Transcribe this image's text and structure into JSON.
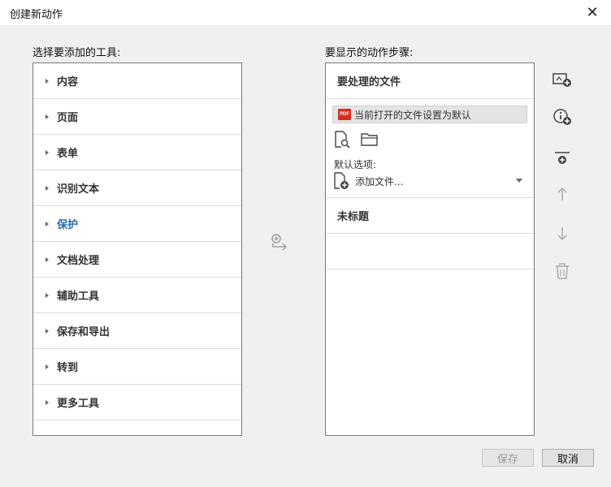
{
  "dialog": {
    "title": "创建新动作",
    "close_label": "✕"
  },
  "tools": {
    "label": "选择要添加的工具:",
    "items": [
      {
        "label": "内容"
      },
      {
        "label": "页面"
      },
      {
        "label": "表单"
      },
      {
        "label": "识别文本"
      },
      {
        "label": "保护"
      },
      {
        "label": "文档处理"
      },
      {
        "label": "辅助工具"
      },
      {
        "label": "保存和导出"
      },
      {
        "label": "转到"
      },
      {
        "label": "更多工具"
      }
    ],
    "active_item": "保护"
  },
  "steps": {
    "label": "要显示的动作步骤:",
    "files_header": "要处理的文件",
    "current_file_option": "当前打开的文件设置为默认",
    "pdf_icon_text": "PDF",
    "default_options_label": "默认选项:",
    "add_files_label": "添加文件...",
    "untitled_label": "未标题"
  },
  "footer": {
    "save_label": "保存",
    "cancel_label": "取消"
  },
  "colors": {
    "active_tool": "#2b6cb0",
    "pdf_red": "#d62d20",
    "disabled_text": "#9a9a9a"
  }
}
